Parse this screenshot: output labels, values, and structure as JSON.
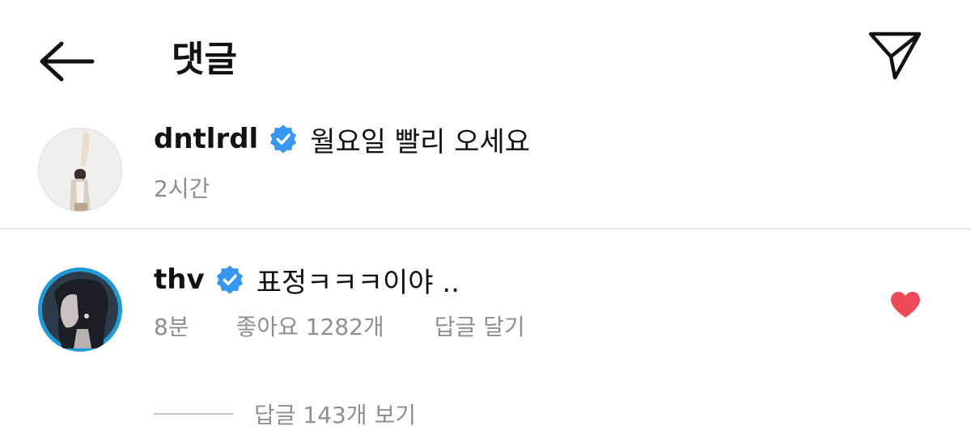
{
  "header": {
    "title": "댓글",
    "back_icon": "arrow-left-icon",
    "share_icon": "paper-plane-icon"
  },
  "comments": [
    {
      "username": "dntlrdl",
      "verified": true,
      "text": "월요일 빨리 오세요",
      "time": "2시간"
    },
    {
      "username": "thv",
      "verified": true,
      "text": "표정ㅋㅋㅋ이야 ..",
      "time": "8분",
      "likes_label": "좋아요 1282개",
      "reply_label": "답글 달기",
      "liked": true,
      "view_replies_label": "답글 143개 보기"
    }
  ],
  "colors": {
    "verified_badge": "#3897f0",
    "like_heart": "#ed4956",
    "meta_text": "#8e8e8e"
  }
}
